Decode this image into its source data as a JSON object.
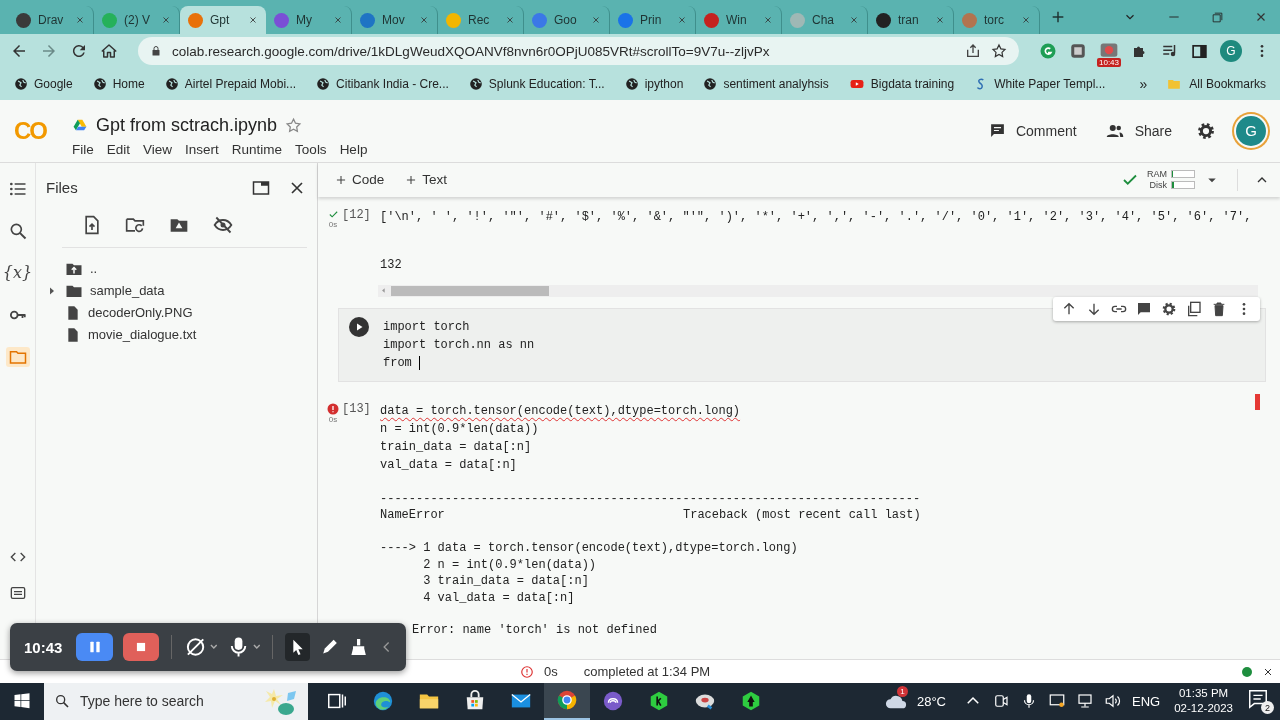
{
  "browser": {
    "tabs": [
      {
        "title": "Drav",
        "selected": false
      },
      {
        "title": "(2) V",
        "selected": false
      },
      {
        "title": "Gpt",
        "selected": true
      },
      {
        "title": "My",
        "selected": false
      },
      {
        "title": "Mov",
        "selected": false
      },
      {
        "title": "Rec",
        "selected": false
      },
      {
        "title": "Goo",
        "selected": false
      },
      {
        "title": "Prin",
        "selected": false
      },
      {
        "title": "Win",
        "selected": false
      },
      {
        "title": "Cha",
        "selected": false
      },
      {
        "title": "tran",
        "selected": false
      },
      {
        "title": "torc",
        "selected": false
      }
    ],
    "address": "colab.research.google.com/drive/1kDLgWeudXQOANVf8nvn6r0OPjU085VRt#scrollTo=9V7u--zljvPx",
    "extension_badge": "10:43",
    "profile": "G",
    "bookmarks": [
      {
        "label": "Google",
        "kind": "globe"
      },
      {
        "label": "Home",
        "kind": "globe"
      },
      {
        "label": "Airtel Prepaid Mobi...",
        "kind": "globe"
      },
      {
        "label": "Citibank India - Cre...",
        "kind": "globe"
      },
      {
        "label": "Splunk Education: T...",
        "kind": "globe"
      },
      {
        "label": "ipython",
        "kind": "globe"
      },
      {
        "label": "sentiment analyhsis",
        "kind": "globe"
      },
      {
        "label": "Bigdata training",
        "kind": "video"
      },
      {
        "label": "White Paper Templ...",
        "kind": "swirl"
      }
    ],
    "more": "»",
    "all_bookmarks": "All Bookmarks"
  },
  "header": {
    "logo": "CO",
    "title": "Gpt from sctrach.ipynb",
    "menu": [
      "File",
      "Edit",
      "View",
      "Insert",
      "Runtime",
      "Tools",
      "Help"
    ],
    "comment": "Comment",
    "share": "Share",
    "avatar": "G"
  },
  "rail": [
    {
      "kind": "contents",
      "selected": false
    },
    {
      "kind": "search",
      "selected": false
    },
    {
      "kind": "variables",
      "label": "{x}",
      "selected": false
    },
    {
      "kind": "secrets",
      "selected": false
    },
    {
      "kind": "files",
      "selected": true
    }
  ],
  "files": {
    "title": "Files",
    "items": [
      {
        "name": "..",
        "kind": "up"
      },
      {
        "name": "sample_data",
        "kind": "folder",
        "expanded": false
      },
      {
        "name": "decoderOnly.PNG",
        "kind": "file"
      },
      {
        "name": "movie_dialogue.txt",
        "kind": "file"
      }
    ]
  },
  "toolbar": {
    "add": [
      "Code",
      "Text"
    ],
    "resources": [
      {
        "label": "RAM",
        "level": 0.05
      },
      {
        "label": "Disk",
        "level": 0.1
      }
    ]
  },
  "cells": [
    {
      "kind": "success",
      "time": "0s",
      "prompt": "[12]",
      "code": [
        {
          "text": "['\\n', ' ', '!', '\"', '#', '$', '%', '&', \"'\", ')', '*', '+', ',', '-', '.', '/', '0', '1', '2', '3', '4', '5', '6', '7',",
          "error": false
        }
      ],
      "output": {
        "text": [
          "132"
        ]
      }
    },
    {
      "kind": "editing",
      "code": [
        {
          "text": "import torch",
          "error": false
        },
        {
          "text": "import torch.nn as nn",
          "error": false
        },
        {
          "text": "from ",
          "error": false
        }
      ]
    },
    {
      "kind": "error",
      "time": "0s",
      "prompt": "[13]",
      "code": [
        {
          "text": "data = torch.tensor(encode(text),dtype=torch.long)",
          "error": true
        },
        {
          "text": "n = int(0.9*len(data))",
          "error": false
        },
        {
          "text": "train_data = data[:n]",
          "error": false
        },
        {
          "text": "val_data = data[:n]",
          "error": false
        }
      ],
      "output": {
        "rule": "---------------------------------------------------------------------------",
        "error_name": "NameError",
        "traceback_title": "Traceback (most recent call last)",
        "traceback_lines": [
          "----> 1 data = torch.tensor(encode(text),dtype=torch.long)",
          "      2 n = int(0.9*len(data))",
          "      3 train_data = data[:n]",
          "      4 val_data = data[:n]"
        ],
        "message": "Error: name 'torch' is not defined"
      }
    }
  ],
  "status_bar": {
    "time": "0s",
    "text": "completed at 1:34 PM"
  },
  "taskbar": {
    "search_placeholder": "Type here to search",
    "weather_badge": "1",
    "temperature": "28°C",
    "language": "ENG",
    "time": "01:35 PM",
    "date": "02-12-2023",
    "notifications": "2"
  },
  "recorder": {
    "time": "10:43"
  }
}
